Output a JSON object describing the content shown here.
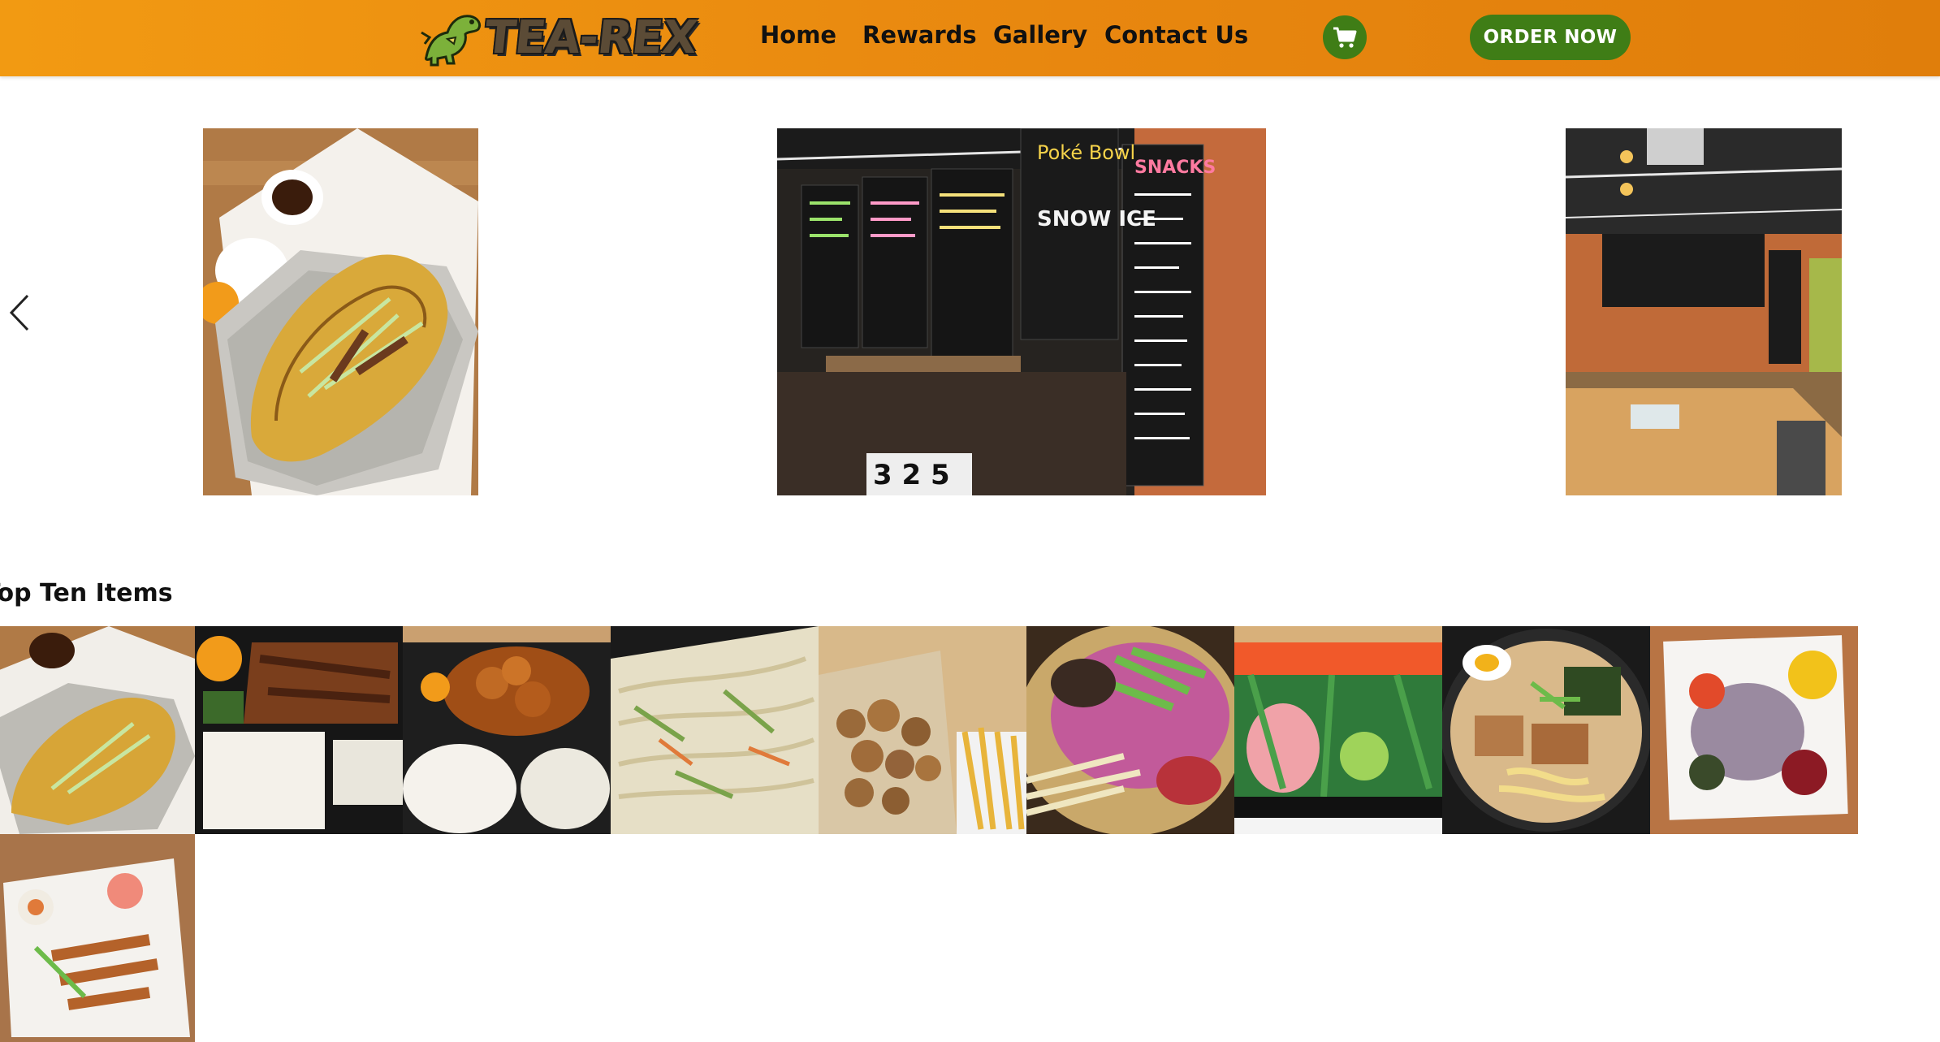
{
  "brand": {
    "logo_text": "TEA-REX",
    "logo_icon": "dinosaur-icon"
  },
  "nav": {
    "items": [
      {
        "label": "Home"
      },
      {
        "label": "Rewards"
      },
      {
        "label": "Gallery"
      },
      {
        "label": "Contact Us"
      }
    ]
  },
  "header": {
    "cart_icon": "cart-icon",
    "order_button": "ORDER NOW",
    "colors": {
      "bar": "#EE8F10",
      "accent": "#3F7D16"
    }
  },
  "carousel": {
    "prev_icon": "chevron-left-icon",
    "slides": [
      {
        "name": "crispy-noodle-dish-photo"
      },
      {
        "name": "menu-boards-photo"
      },
      {
        "name": "restaurant-interior-photo"
      }
    ],
    "menu_board_text": [
      "Poké Bowl",
      "SNOW ICE",
      "SNACKS",
      "3 2 5"
    ]
  },
  "top_items": {
    "title": "Top Ten Items",
    "items": [
      {
        "name": "crispy-noodle"
      },
      {
        "name": "teriyaki-bento"
      },
      {
        "name": "orange-chicken-bento"
      },
      {
        "name": "stir-fried-noodles"
      },
      {
        "name": "popcorn-chicken-fries"
      },
      {
        "name": "poke-bowl"
      },
      {
        "name": "sashimi-platter"
      },
      {
        "name": "ramen"
      },
      {
        "name": "poke-salad"
      },
      {
        "name": "sushi-plate"
      }
    ]
  }
}
